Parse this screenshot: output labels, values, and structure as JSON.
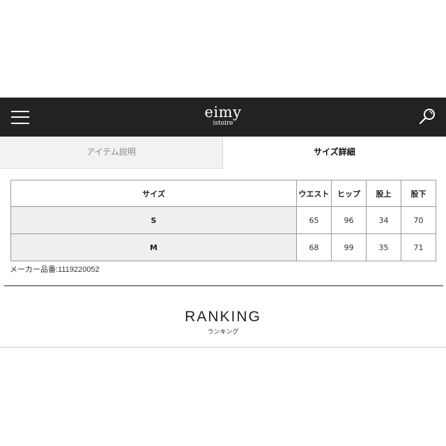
{
  "header": {
    "logo_main": "eimy",
    "logo_sub": "istoire",
    "menu_icon": "hamburger-menu-icon",
    "search_icon": "search-icon",
    "background": "#222222"
  },
  "tabs": [
    {
      "label": "アイテム説明",
      "active": false
    },
    {
      "label": "サイズ詳細",
      "active": true
    }
  ],
  "size_table": {
    "headers": [
      "サイズ",
      "ウエスト",
      "ヒップ",
      "股上",
      "股下"
    ],
    "rows": [
      {
        "size": "S",
        "values": [
          "65",
          "96",
          "34",
          "70"
        ]
      },
      {
        "size": "M",
        "values": [
          "68",
          "99",
          "35",
          "71"
        ]
      }
    ]
  },
  "maker_number": "メーカー品番:1119220052",
  "ranking": {
    "title": "RANKING",
    "subtitle": "ランキング"
  }
}
